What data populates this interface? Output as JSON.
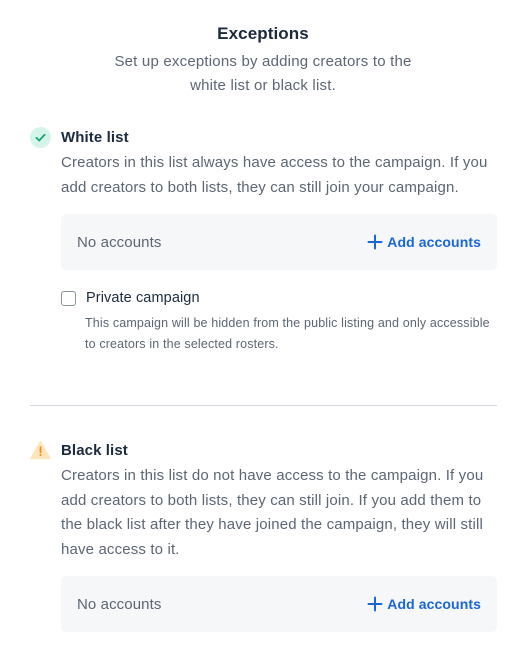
{
  "header": {
    "title": "Exceptions",
    "subtitle": "Set up exceptions by adding creators to the white list or black list."
  },
  "white_list": {
    "icon": "check-circle-icon",
    "title": "White list",
    "description": "Creators in this list always have access to the campaign. If you add creators to both lists, they can still join your campaign.",
    "accounts_empty": "No accounts",
    "add_label": "Add accounts",
    "private_campaign": {
      "checked": false,
      "label": "Private campaign",
      "note": "This campaign will be hidden from the public listing and only accessible to creators in the selected rosters."
    }
  },
  "black_list": {
    "icon": "warning-triangle-icon",
    "title": "Black list",
    "description": "Creators in this list do not have access to the campaign. If you add creators to both lists, they can still join. If you add them to the black list after they have joined the campaign, they will still have access to it.",
    "accounts_empty": "No accounts",
    "add_label": "Add accounts"
  },
  "colors": {
    "accent": "#1a66d6",
    "success_bg": "#d6f5ea",
    "success_fg": "#17a673",
    "warning": "#f5a623",
    "text_primary": "#1b2a3c",
    "text_secondary": "#5c6673",
    "box_bg": "#f6f7f9"
  }
}
